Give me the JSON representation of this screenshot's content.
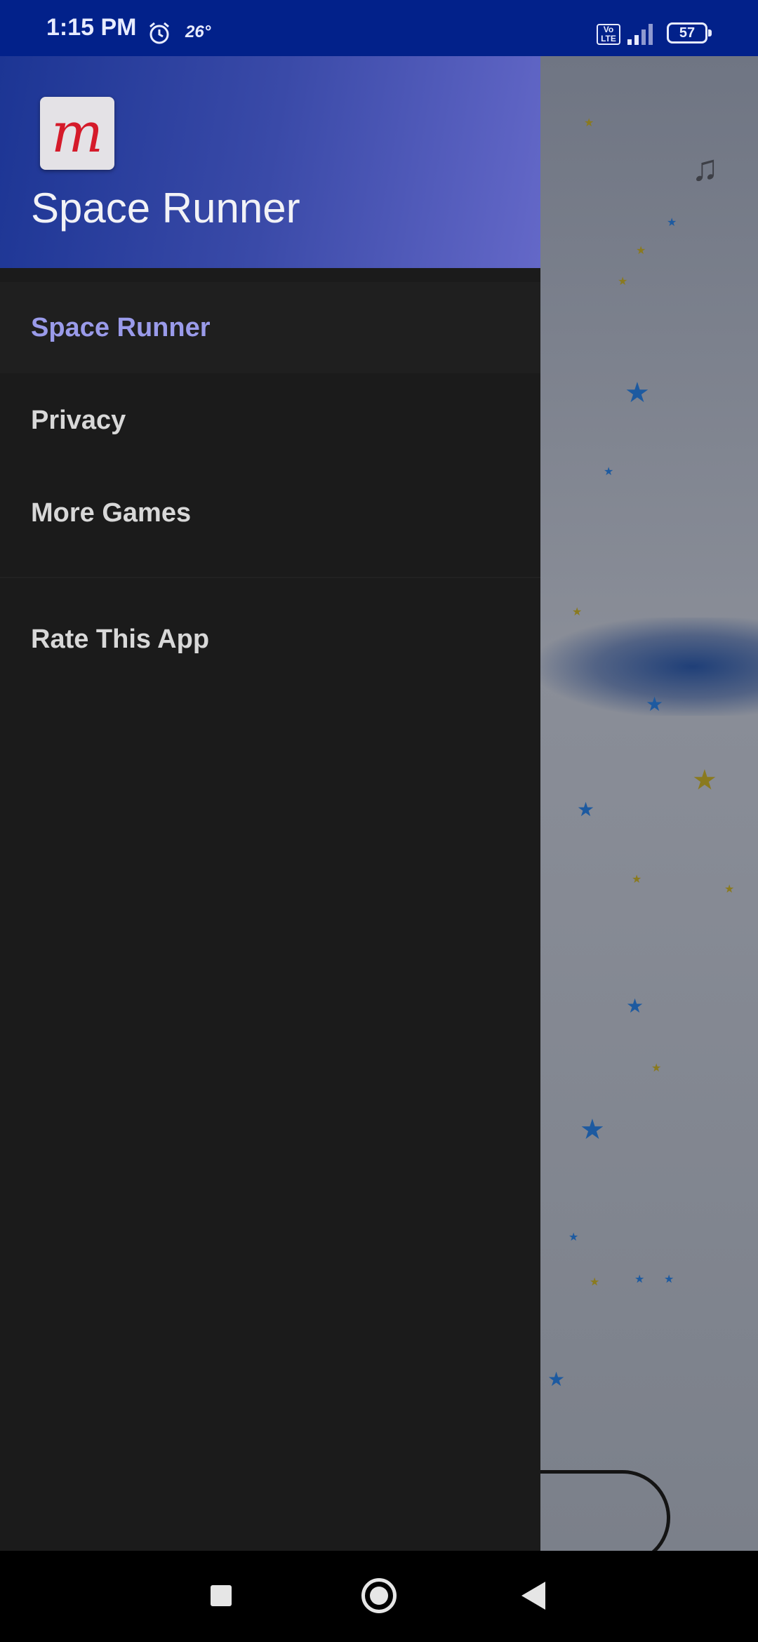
{
  "status_bar": {
    "time": "1:15 PM",
    "temperature": "26°",
    "volte_label": "Vo\nLTE",
    "battery": "57",
    "icons": [
      "alarm-icon",
      "volte-icon",
      "signal-icon",
      "battery-icon"
    ]
  },
  "drawer": {
    "app_title": "Space Runner",
    "logo_letter": "m",
    "items": [
      {
        "label": "Space Runner",
        "active": true
      },
      {
        "label": "Privacy",
        "active": false
      },
      {
        "label": "More Games",
        "active": false
      },
      {
        "label": "Rate This App",
        "active": false
      }
    ]
  },
  "background": {
    "music_icon": "♫",
    "icons": [
      "music-note-icon"
    ]
  },
  "nav_bar": {
    "icons": [
      "recents-square-icon",
      "home-circle-icon",
      "back-triangle-icon"
    ]
  },
  "colors": {
    "status_bar": "#02218a",
    "drawer_header_start": "#1c3594",
    "drawer_header_end": "#6468c8",
    "drawer_bg": "#1b1b1b",
    "active_item": "#9a9bea",
    "logo_letter": "#d51a2a"
  }
}
